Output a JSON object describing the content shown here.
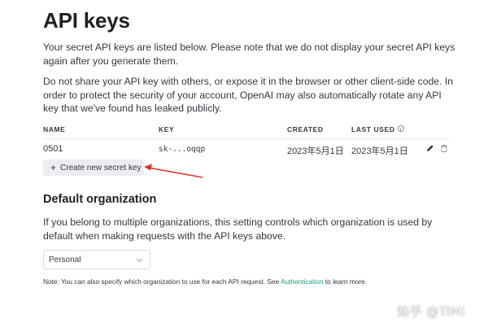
{
  "page": {
    "title": "API keys",
    "intro": "Your secret API keys are listed below. Please note that we do not display your secret API keys again after you generate them.",
    "warning": "Do not share your API key with others, or expose it in the browser or other client-side code. In order to protect the security of your account, OpenAI may also automatically rotate any API key that we've found has leaked publicly."
  },
  "table": {
    "headers": {
      "name": "NAME",
      "key": "KEY",
      "created": "CREATED",
      "last_used": "LAST USED"
    },
    "rows": [
      {
        "name": "0501",
        "key": "sk-...oqqp",
        "created": "2023年5月1日",
        "last_used": "2023年5月1日"
      }
    ]
  },
  "create_button": {
    "label": "Create new secret key",
    "icon": "plus-icon"
  },
  "annotation": {
    "color": "#e0312b",
    "icon": "red-arrow"
  },
  "org": {
    "title": "Default organization",
    "description": "If you belong to multiple organizations, this setting controls which organization is used by default when making requests with the API keys above.",
    "selected": "Personal",
    "note_prefix": "Note: You can also specify which organization to use for each API request. See ",
    "note_link": "Authentication",
    "note_suffix": " to learn more."
  },
  "watermark": "知乎 @TiMi",
  "colors": {
    "accent": "#10a37f",
    "button_bg": "#ececf1",
    "text": "#353740"
  }
}
